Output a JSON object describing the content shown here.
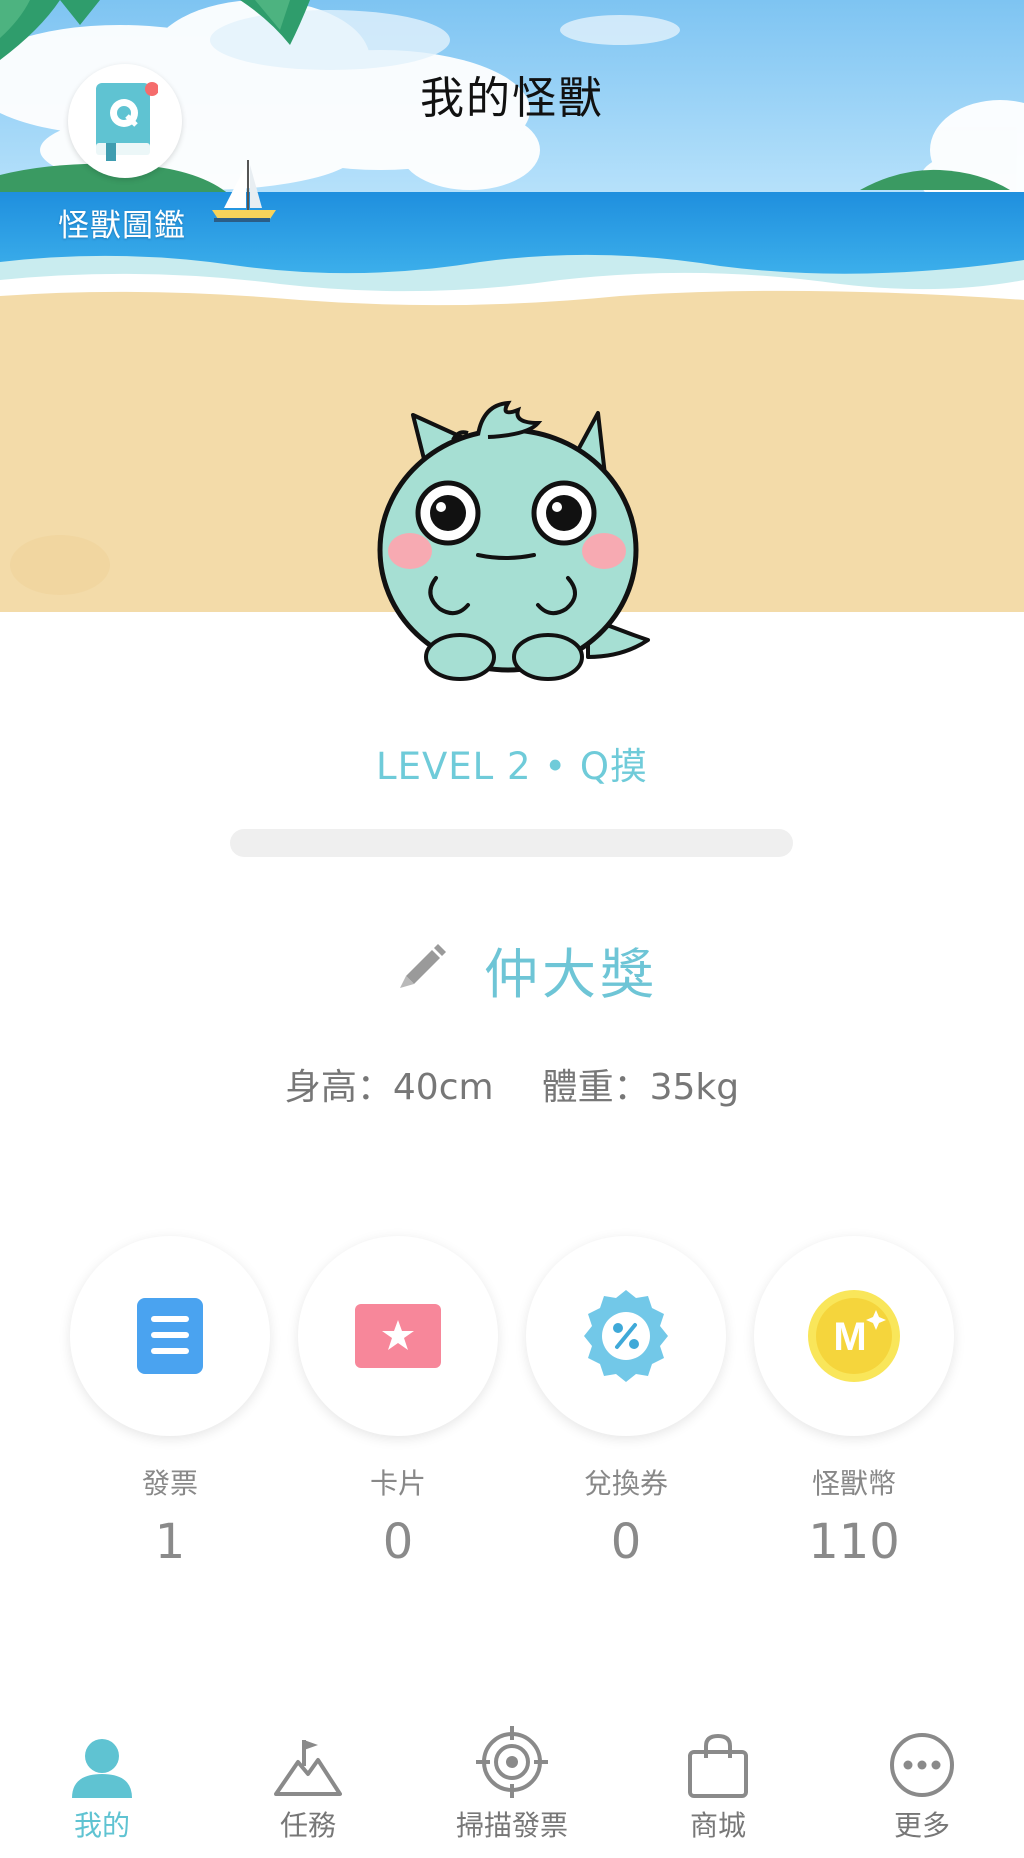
{
  "header": {
    "title": "我的怪獸"
  },
  "monster_dex": {
    "label": "怪獸圖鑑"
  },
  "monster": {
    "level_label": "LEVEL 2 • Q摸",
    "progress": 0,
    "name": "仲大獎",
    "height_label": "身高：40cm",
    "weight_label": "體重：35kg"
  },
  "assets": [
    {
      "label": "發票",
      "value": "1",
      "icon": "invoice-icon"
    },
    {
      "label": "卡片",
      "value": "0",
      "icon": "card-icon"
    },
    {
      "label": "兌換券",
      "value": "0",
      "icon": "coupon-icon"
    },
    {
      "label": "怪獸幣",
      "value": "110",
      "icon": "monster-coin-icon"
    }
  ],
  "nav": [
    {
      "label": "我的",
      "icon": "person-icon",
      "active": true
    },
    {
      "label": "任務",
      "icon": "mountain-flag-icon"
    },
    {
      "label": "掃描發票",
      "icon": "target-scan-icon"
    },
    {
      "label": "商城",
      "icon": "shopping-bag-icon"
    },
    {
      "label": "更多",
      "icon": "more-dots-icon"
    }
  ],
  "colors": {
    "accent": "#6fcbd9",
    "sky": "#8fcdf3",
    "sea": "#1c93df",
    "sand": "#f3dba9",
    "monster": "#a6dfd3"
  }
}
